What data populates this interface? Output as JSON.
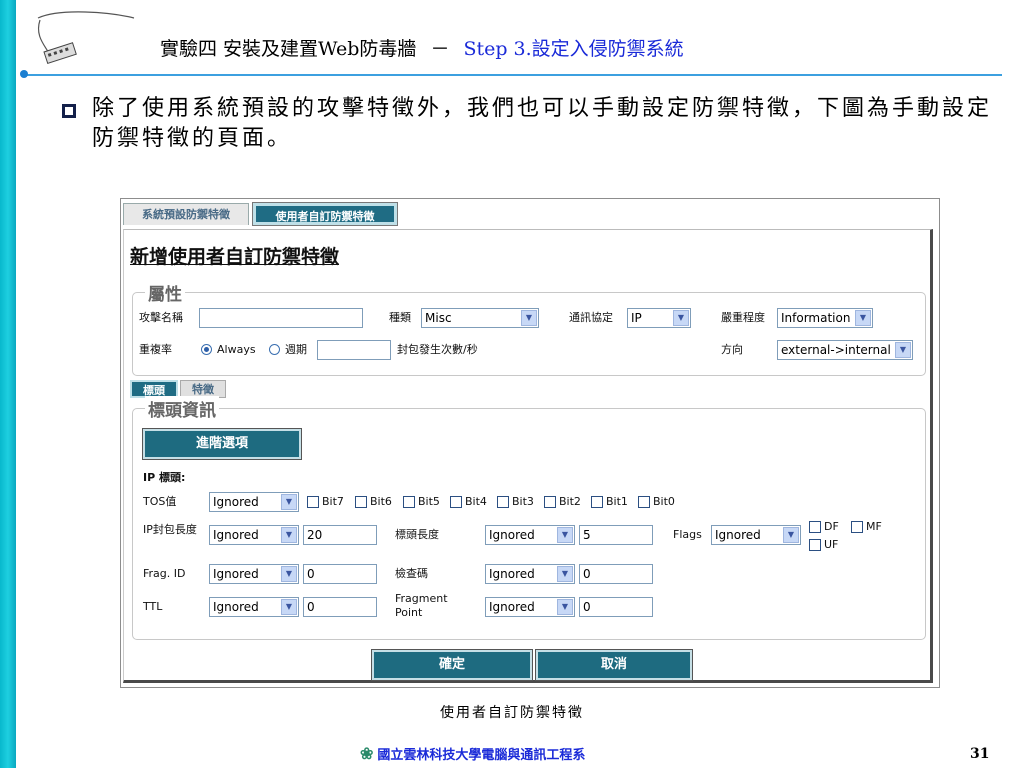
{
  "slide": {
    "title_main": "實驗四 安裝及建置Web防毒牆",
    "title_dash": "－",
    "title_step": "Step 3.設定入侵防禦系統",
    "bullet": "除了使用系統預設的攻擊特徵外，我們也可以手動設定防禦特徵，下圖為手動設定防禦特徵的頁面。",
    "caption": "使用者自訂防禦特徵",
    "footer": "國立雲林科技大學電腦與通訊工程系",
    "page_number": "31",
    "colors": {
      "left_bar": "#1ecfe0",
      "title_accent": "#1a2ad8",
      "button": "#1e6b80"
    }
  },
  "screenshot": {
    "tabs": {
      "system": "系統預設防禦特徵",
      "user": "使用者自訂防禦特徵"
    },
    "panel_title": "新增使用者自訂防禦特徵",
    "attributes": {
      "legend": "屬性",
      "attack_name_label": "攻擊名稱",
      "attack_name_value": "",
      "category_label": "種類",
      "category_value": "Misc",
      "protocol_label": "通訊協定",
      "protocol_value": "IP",
      "severity_label": "嚴重程度",
      "severity_value": "Information",
      "repeat_label": "重複率",
      "always_label": "Always",
      "period_label": "週期",
      "period_value": "",
      "packets_label": "封包發生次數/秒",
      "direction_label": "方向",
      "direction_value": "external->internal"
    },
    "subtabs": {
      "header": "標頭",
      "signature": "特徵"
    },
    "header_info": {
      "legend": "標頭資訊",
      "route_button": "進階選項",
      "ip_header_label": "IP 標頭:",
      "tos_label": "TOS值",
      "tos_value": "Ignored",
      "bits": [
        "Bit7",
        "Bit6",
        "Bit5",
        "Bit4",
        "Bit3",
        "Bit2",
        "Bit1",
        "Bit0"
      ],
      "ip_len_label": "IP封包長度",
      "ip_len_op": "Ignored",
      "ip_len_value": "20",
      "hdr_len_label": "標頭長度",
      "hdr_len_op": "Ignored",
      "hdr_len_value": "5",
      "flags_label": "Flags",
      "flags_op": "Ignored",
      "flag_df": "DF",
      "flag_mf": "MF",
      "flag_uf": "UF",
      "frag_id_label": "Frag. ID",
      "frag_id_op": "Ignored",
      "frag_id_value": "0",
      "checksum_label": "檢查碼",
      "checksum_op": "Ignored",
      "checksum_value": "0",
      "ttl_label": "TTL",
      "ttl_op": "Ignored",
      "ttl_value": "0",
      "frag_point_label": "Fragment Point",
      "frag_point_op": "Ignored",
      "frag_point_value": "0"
    },
    "buttons": {
      "ok": "確定",
      "cancel": "取消"
    }
  }
}
